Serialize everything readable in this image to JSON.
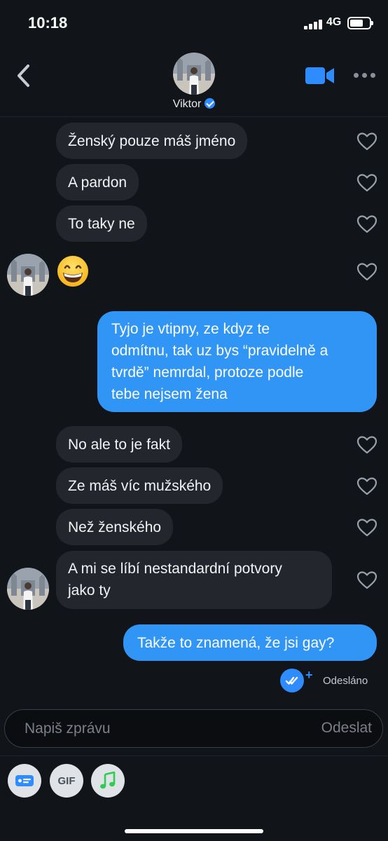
{
  "status_bar": {
    "time": "10:18",
    "network": "4G"
  },
  "header": {
    "contact_name": "Viktor"
  },
  "messages": [
    {
      "side": "in",
      "text": "Ženský pouze máš jméno"
    },
    {
      "side": "in",
      "text": "A pardon"
    },
    {
      "side": "in",
      "text": "To taky ne"
    },
    {
      "side": "in",
      "emoji": "grinning-face"
    },
    {
      "side": "out",
      "lines": [
        "Tyjo je vtipny, ze kdyz te",
        "odmítnu, tak uz bys “pravidelně a",
        "tvrdě” nemrdal, protoze podle",
        "tebe nejsem žena"
      ]
    },
    {
      "side": "in",
      "text": "No ale to je fakt"
    },
    {
      "side": "in",
      "text": "Ze máš víc mužského"
    },
    {
      "side": "in",
      "text": "Než ženského"
    },
    {
      "side": "in",
      "lines": [
        "A mi se líbí nestandardní potvory",
        "jako ty"
      ]
    },
    {
      "side": "out",
      "text": "Takže to znamená, že jsi gay?"
    }
  ],
  "delivery": {
    "status": "Odesláno"
  },
  "composer": {
    "placeholder": "Napiš zprávu",
    "send_label": "Odeslat"
  },
  "toolbar": {
    "gif_label": "GIF"
  },
  "colors": {
    "background": "#111419",
    "incoming_bubble": "#23262d",
    "outgoing_bubble": "#3095f4",
    "accent": "#2f8cff",
    "music_icon": "#2ecc52"
  }
}
